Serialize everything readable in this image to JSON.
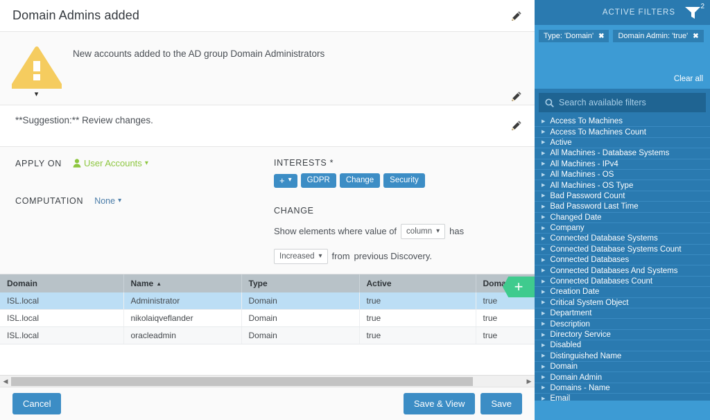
{
  "header": {
    "title": "Domain Admins added",
    "edit_icon": "pencil-icon"
  },
  "description": {
    "icon": "warning-triangle-icon",
    "expand_icon": "chevron-down-icon",
    "text": "New accounts added to the AD group Domain Administrators",
    "edit_icon": "pencil-icon"
  },
  "suggestion": {
    "text": "**Suggestion:** Review changes.",
    "edit_icon": "pencil-icon"
  },
  "config": {
    "apply_on": {
      "label": "APPLY ON",
      "value": "User Accounts",
      "icon": "user-icon",
      "chevron": "chevron-down-icon"
    },
    "computation": {
      "label": "COMPUTATION",
      "value": "None",
      "chevron": "chevron-down-icon"
    },
    "interests": {
      "label": "INTERESTS *",
      "add_label": "+",
      "add_chevron": "chevron-down-icon",
      "badges": [
        "GDPR",
        "Change",
        "Security"
      ]
    },
    "change": {
      "label": "CHANGE",
      "text_before": "Show elements where value of",
      "column_select": "column",
      "text_middle": "has",
      "direction_select": "Increased",
      "text_after": "from",
      "text_end": "previous Discovery."
    }
  },
  "table": {
    "columns": [
      "Domain",
      "Name",
      "Type",
      "Active",
      "Domain A"
    ],
    "sort_column": "Name",
    "sort_icon": "sort-asc-icon",
    "add_column_button": "+",
    "rows": [
      {
        "cells": [
          "ISL.local",
          "Administrator",
          "Domain",
          "true",
          "true"
        ],
        "selected": true
      },
      {
        "cells": [
          "ISL.local",
          "nikolaiqveflander",
          "Domain",
          "true",
          "true"
        ],
        "selected": false
      },
      {
        "cells": [
          "ISL.local",
          "oracleadmin",
          "Domain",
          "true",
          "true"
        ],
        "selected": false
      }
    ],
    "scroll_left_icon": "triangle-left-icon",
    "scroll_right_icon": "triangle-right-icon"
  },
  "footer": {
    "cancel": "Cancel",
    "save_and_view": "Save & View",
    "save": "Save"
  },
  "filters": {
    "header_title": "ACTIVE FILTERS",
    "funnel_icon": "funnel-icon",
    "active_count": "2",
    "chips": [
      {
        "label": "Type: 'Domain'",
        "remove_icon": "close-icon"
      },
      {
        "label": "Domain Admin: 'true'",
        "remove_icon": "close-icon"
      }
    ],
    "clear_all": "Clear all",
    "search": {
      "icon": "search-icon",
      "placeholder": "Search available filters",
      "value": ""
    },
    "available": [
      "Access To Machines",
      "Access To Machines Count",
      "Active",
      "All Machines - Database Systems",
      "All Machines - IPv4",
      "All Machines - OS",
      "All Machines - OS Type",
      "Bad Password Count",
      "Bad Password Last Time",
      "Changed Date",
      "Company",
      "Connected Database Systems",
      "Connected Database Systems Count",
      "Connected Databases",
      "Connected Databases And Systems",
      "Connected Databases Count",
      "Creation Date",
      "Critical System Object",
      "Department",
      "Description",
      "Directory Service",
      "Disabled",
      "Distinguished Name",
      "Domain",
      "Domain Admin",
      "Domains - Name",
      "Email"
    ],
    "expand_icon": "triangle-right-icon"
  },
  "colors": {
    "brand_blue": "#3c8dc5",
    "panel_blue": "#2a7ab0",
    "active_blue": "#3d9bd4",
    "warning_amber": "#f5cc5f",
    "accent_green": "#8dc63f",
    "add_green": "#3fcb8e",
    "row_selected": "#bcdef5",
    "table_header": "#b8c2c8"
  }
}
